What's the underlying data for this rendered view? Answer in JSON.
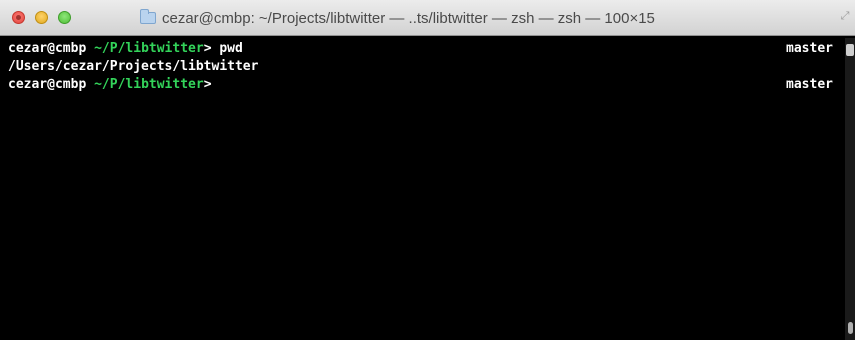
{
  "window": {
    "title": "cezar@cmbp: ~/Projects/libtwitter — ..ts/libtwitter — zsh — zsh — 100×15"
  },
  "terminal": {
    "lines": [
      {
        "user_host": "cezar@cmbp",
        "path": "~/P/libtwitter",
        "prompt_char": ">",
        "command": " pwd",
        "rprompt": "master"
      },
      {
        "output": "/Users/cezar/Projects/libtwitter"
      },
      {
        "user_host": "cezar@cmbp",
        "path": "~/P/libtwitter",
        "prompt_char": ">",
        "command": "",
        "rprompt": "master"
      }
    ]
  },
  "colors": {
    "path_green": "#33d45a",
    "text_white": "#ffffff",
    "background": "#000000"
  },
  "icons": {
    "close": "close-button",
    "minimize": "minimize-button",
    "zoom": "zoom-button",
    "folder": "folder-icon",
    "resize": "fullscreen-icon"
  }
}
